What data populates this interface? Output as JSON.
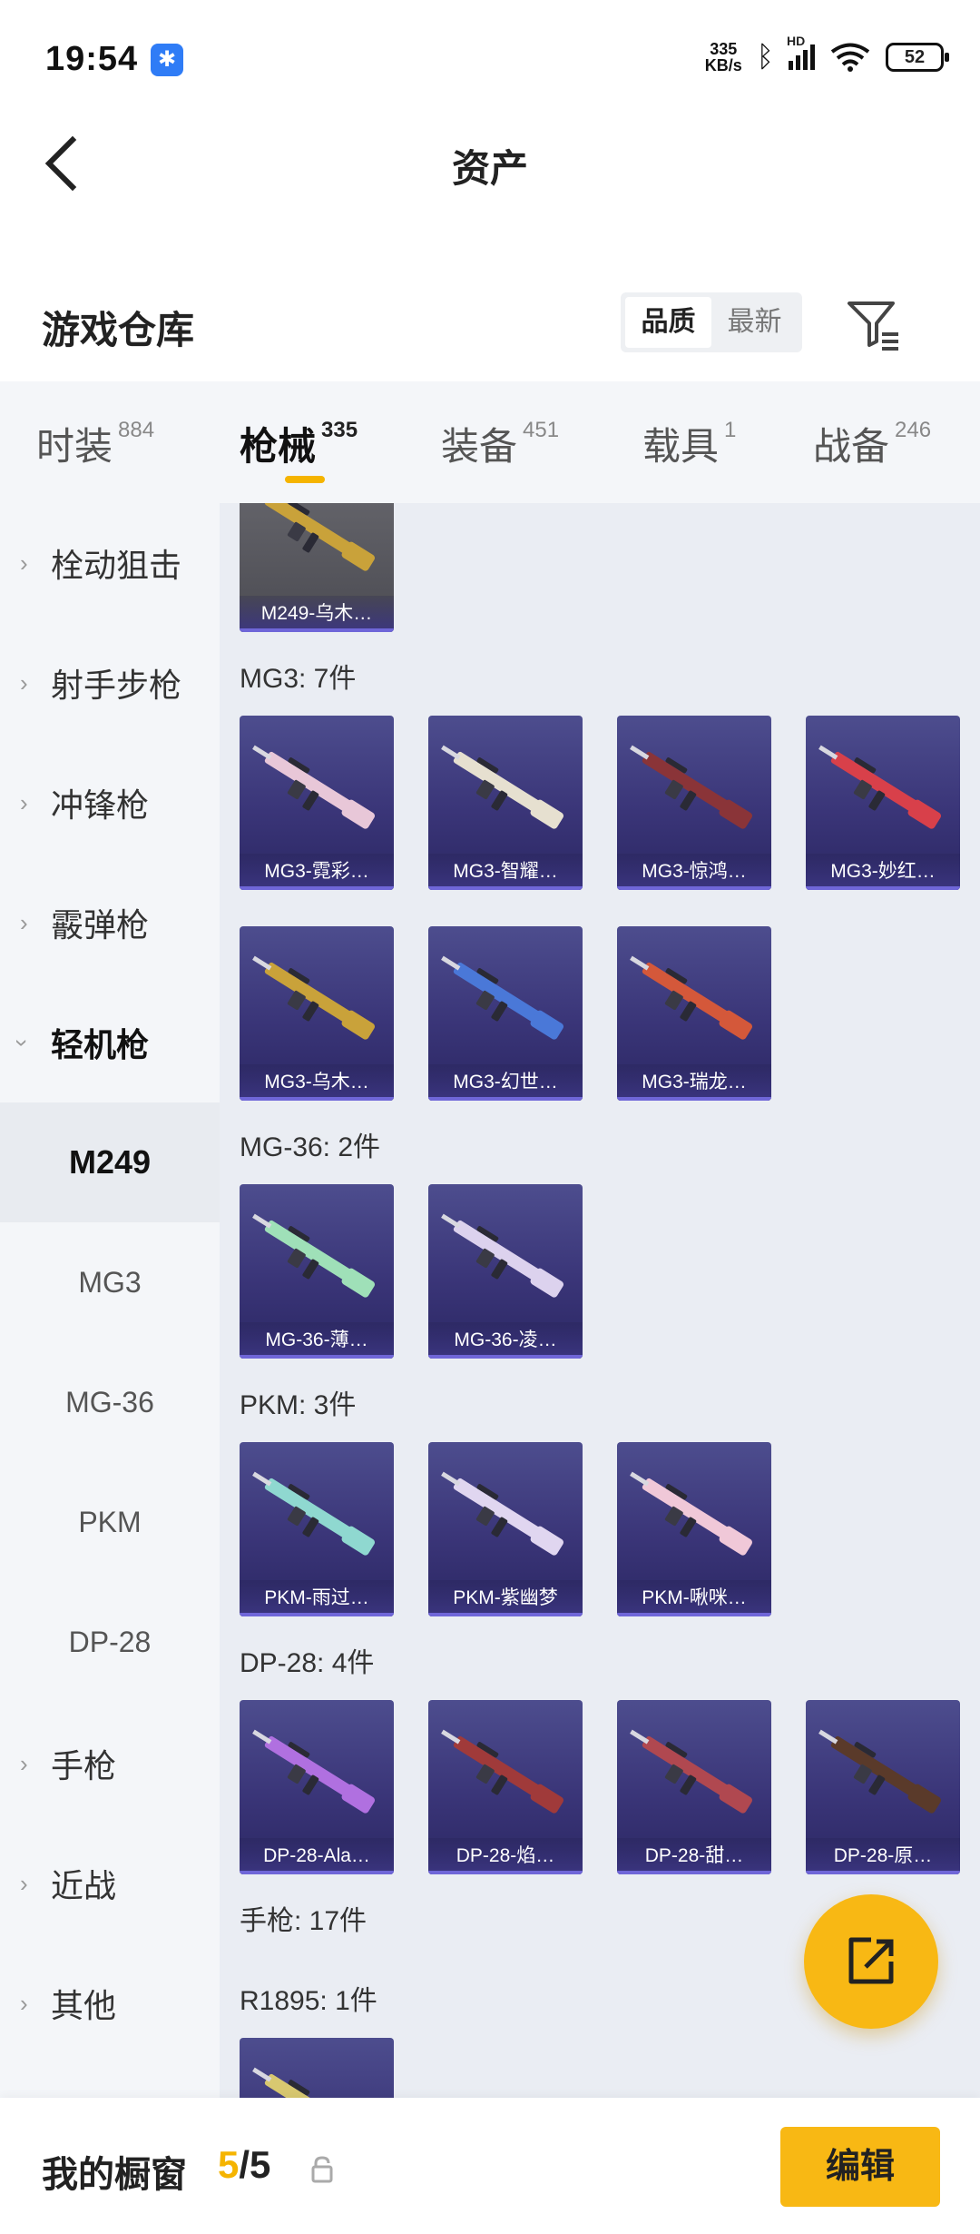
{
  "status_bar": {
    "time": "19:54",
    "net_speed_value": "335",
    "net_speed_unit": "KB/s",
    "signal_label": "HD",
    "battery": "52"
  },
  "nav": {
    "title": "资产"
  },
  "warehouse": {
    "title": "游戏仓库",
    "sort_options": [
      "品质",
      "最新"
    ],
    "active_sort": "品质"
  },
  "tabs": [
    {
      "label": "时装",
      "count": "884"
    },
    {
      "label": "枪械",
      "count": "335"
    },
    {
      "label": "装备",
      "count": "451"
    },
    {
      "label": "载具",
      "count": "1"
    },
    {
      "label": "战备",
      "count": "246"
    }
  ],
  "side_menu": {
    "categories": [
      {
        "label": "栓动狙击"
      },
      {
        "label": "射手步枪"
      },
      {
        "label": "冲锋枪"
      },
      {
        "label": "霰弹枪"
      },
      {
        "label": "轻机枪"
      }
    ],
    "subitems": [
      "M249",
      "MG3",
      "MG-36",
      "PKM",
      "DP-28"
    ],
    "more_categories": [
      "手枪",
      "近战",
      "其他"
    ]
  },
  "content": {
    "top_partial_card": "M249-乌木…",
    "groups": [
      {
        "title": "MG3: 7件",
        "items": [
          "MG3-霓彩…",
          "MG3-智耀…",
          "MG3-惊鸿…",
          "MG3-妙红…",
          "MG3-乌木…",
          "MG3-幻世…",
          "MG3-瑞龙…"
        ]
      },
      {
        "title": "MG-36: 2件",
        "items": [
          "MG-36-薄…",
          "MG-36-凌…"
        ]
      },
      {
        "title": "PKM: 3件",
        "items": [
          "PKM-雨过…",
          "PKM-紫幽梦",
          "PKM-啾咪…"
        ]
      },
      {
        "title": "DP-28: 4件",
        "items": [
          "DP-28-Ala…",
          "DP-28-焰…",
          "DP-28-甜…",
          "DP-28-原…"
        ]
      }
    ],
    "section_pistol": "手枪: 17件",
    "subgroup_r1895": "R1895: 1件"
  },
  "bottom_bar": {
    "showcase_label": "我的橱窗",
    "showcase_current": "5",
    "showcase_total": "/5",
    "edit_label": "编辑"
  },
  "colors": {
    "accent": "#f8b814",
    "card_bg": "#3a3578",
    "content_bg": "#eaedf3",
    "side_bg": "#f4f6f9"
  }
}
